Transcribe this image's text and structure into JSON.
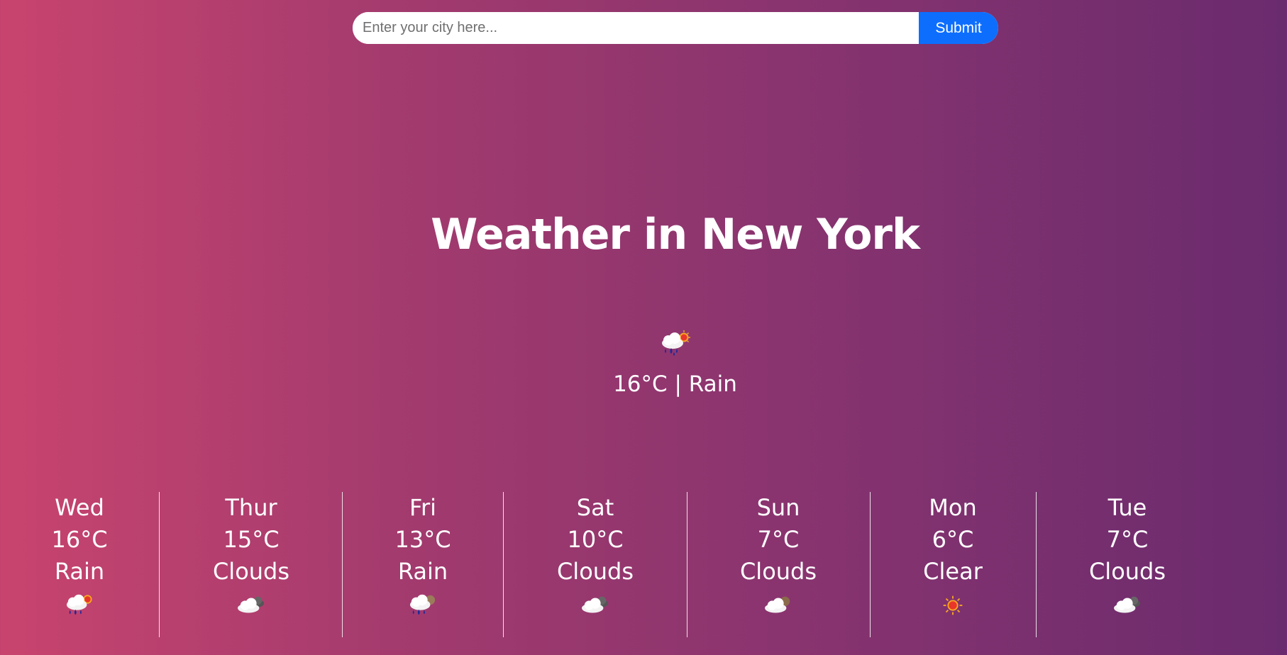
{
  "search": {
    "placeholder": "Enter your city here...",
    "submit_label": "Submit"
  },
  "title": "Weather in New York",
  "current": {
    "temp": "16°C",
    "separator": "|",
    "condition": "Rain",
    "summary": "16°C | Rain",
    "icon": "rain-sun-icon"
  },
  "forecast": [
    {
      "day": "Wed",
      "temp": "16°C",
      "condition": "Rain",
      "icon": "rain-sun-icon"
    },
    {
      "day": "Thur",
      "temp": "15°C",
      "condition": "Clouds",
      "icon": "clouds-icon"
    },
    {
      "day": "Fri",
      "temp": "13°C",
      "condition": "Rain",
      "icon": "rain-cloud-icon"
    },
    {
      "day": "Sat",
      "temp": "10°C",
      "condition": "Clouds",
      "icon": "clouds-icon"
    },
    {
      "day": "Sun",
      "temp": "7°C",
      "condition": "Clouds",
      "icon": "clouds-brown-icon"
    },
    {
      "day": "Mon",
      "temp": "6°C",
      "condition": "Clear",
      "icon": "sun-icon"
    },
    {
      "day": "Tue",
      "temp": "7°C",
      "condition": "Clouds",
      "icon": "clouds-icon"
    }
  ],
  "colors": {
    "gradient_start": "#c8446e",
    "gradient_end": "#6a2b6e",
    "submit_bg": "#0d6efd"
  }
}
